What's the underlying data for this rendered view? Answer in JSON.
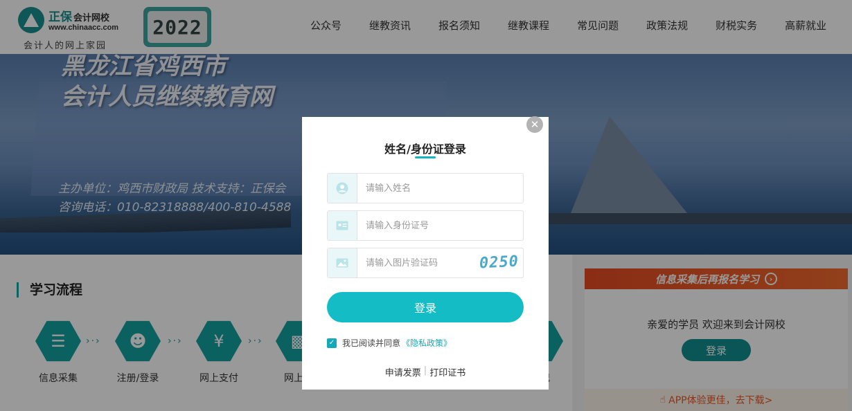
{
  "header": {
    "logo_cn": "正保",
    "logo_cn_sub": "会计网校",
    "logo_url": "www.chinaacc.com",
    "slogan": "会计人的网上家园",
    "year": "2022",
    "nav": [
      "公众号",
      "继教资讯",
      "报名须知",
      "继教课程",
      "常见问题",
      "政策法规",
      "财税实务",
      "高薪就业"
    ]
  },
  "banner": {
    "title_line1": "黑龙江省鸡西市",
    "title_line2": "会计人员继续教育网",
    "sponsor": "主办单位：鸡西市财政局    技术支持：正保会",
    "phone": "咨询电话：010-82318888/400-810-4588"
  },
  "flow": {
    "title": "学习流程",
    "steps": [
      {
        "label": "信息采集",
        "icon": "clipboard-icon"
      },
      {
        "label": "注册/登录",
        "icon": "user-check-icon"
      },
      {
        "label": "网上支付",
        "icon": "money-bag-icon"
      },
      {
        "label": "网上学",
        "icon": "screen-icon"
      }
    ],
    "last_step_fragment": "登记"
  },
  "side": {
    "banner_text": "信息采集后再报名学习",
    "welcome": "亲爱的学员 欢迎来到会计网校",
    "login_label": "登录",
    "app_text": "APP体验更佳，去下载>"
  },
  "modal": {
    "title": "姓名/身份证登录",
    "name_placeholder": "请输入姓名",
    "id_placeholder": "请输入身份证号",
    "captcha_placeholder": "请输入图片验证码",
    "captcha_code": "0250",
    "login_label": "登录",
    "agree_text": "我已阅读并同意",
    "privacy_link": "《隐私政策》",
    "invoice_link": "申请发票",
    "print_link": "打印证书",
    "close_label": "✕"
  },
  "colors": {
    "accent": "#14bcc6",
    "brand": "#1a8f8f",
    "orange": "#e64b22"
  }
}
